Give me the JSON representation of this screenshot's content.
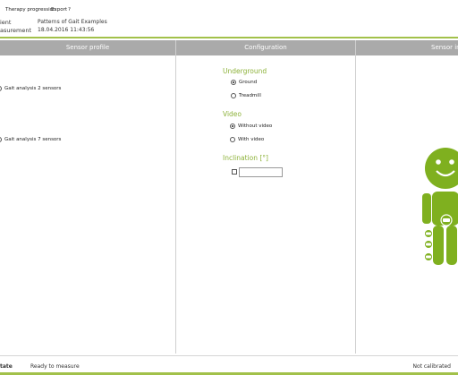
{
  "menu": {
    "therapy_progression": "Therapy progression",
    "export": "Export",
    "help": "?"
  },
  "info": {
    "patient_label": "ient",
    "patient_value": "Patterns of Gait Examples",
    "measurement_label": "asurement",
    "measurement_value": "18.04.2016 11:43:56"
  },
  "columns": {
    "sensor_profile": "Sensor profile",
    "configuration": "Configuration",
    "sensor_info": "Sensor in"
  },
  "sensor_profiles": [
    {
      "label": "Gait analysis 2 sensors",
      "selected": true
    },
    {
      "label": "Gait analysis 7 sensors",
      "selected": false
    }
  ],
  "config": {
    "underground_title": "Underground",
    "underground_options": [
      {
        "label": "Ground",
        "selected": true
      },
      {
        "label": "Treadmill",
        "selected": false
      }
    ],
    "video_title": "Video",
    "video_options": [
      {
        "label": "Without video",
        "selected": true
      },
      {
        "label": "With video",
        "selected": false
      }
    ],
    "inclination_title": "Inclination [°]",
    "inclination_checked": false,
    "inclination_value": ""
  },
  "status": {
    "label": "tate",
    "text": "Ready to measure",
    "calibration": "Not calibrated"
  },
  "colors": {
    "accent": "#a2c14a",
    "figure": "#7fb01f",
    "header": "#aaaaaa"
  }
}
